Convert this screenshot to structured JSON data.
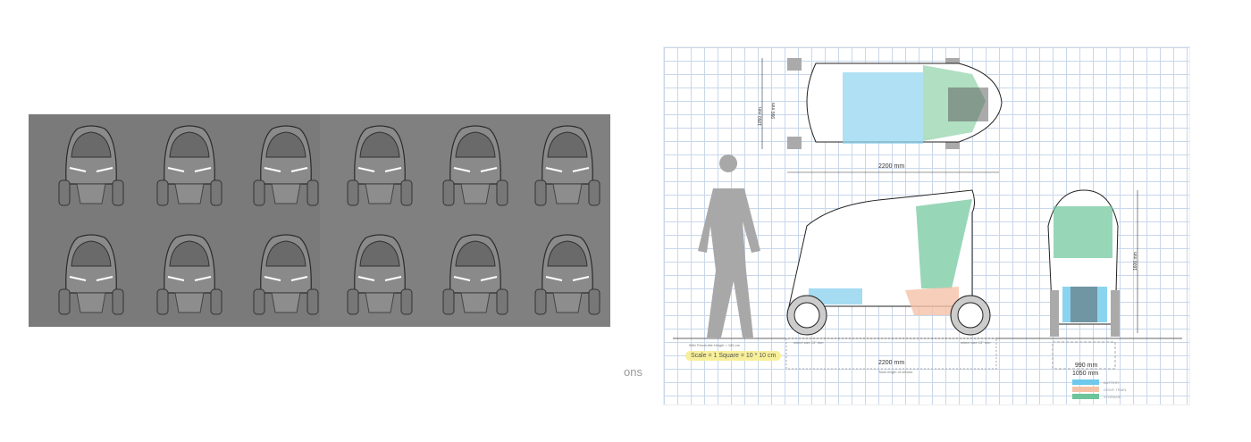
{
  "top_view": {
    "width_outer": "1050 mm",
    "width_inner": "990 mm",
    "length": "2200 mm"
  },
  "side_view": {
    "human_caption": "95th Percentile Height = 185 cm",
    "scale": "Scale = 1 Square = 10 * 10 cm",
    "front_wheel": "wheel size 13\" trim",
    "rear_wheel": "wheel size 13\" trim",
    "length": "2200 mm",
    "length_caption": "Total length of vehicle"
  },
  "front_view": {
    "height": "1600 mm",
    "inner_width": "990 mm",
    "outer_width": "1050 mm"
  },
  "legend": [
    {
      "label": "BATTERY",
      "color": "#6ec9ec"
    },
    {
      "label": "DRIVE TRAIN",
      "color": "#f5c2a8"
    },
    {
      "label": "STORAGE",
      "color": "#6cc49a"
    }
  ],
  "faint_text": "ons"
}
